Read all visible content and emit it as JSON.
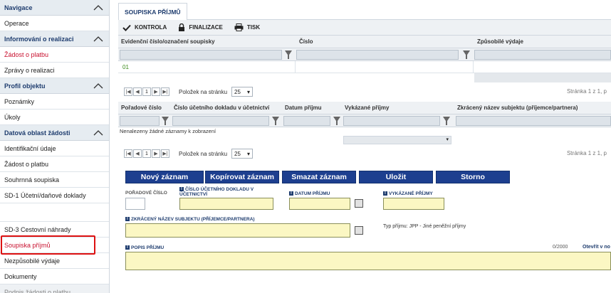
{
  "sidebar": {
    "sections": [
      {
        "title": "Navigace",
        "items": [
          "Operace"
        ]
      },
      {
        "title": "Informování o realizaci",
        "items": [
          "Žádost o platbu",
          "Zprávy o realizaci"
        ]
      },
      {
        "title": "Profil objektu",
        "items": [
          "Poznámky",
          "Úkoly"
        ]
      },
      {
        "title": "Datová oblast žádosti",
        "items": [
          "Identifikační údaje",
          "Žádost o platbu",
          "Souhrnná soupiska",
          "SD-1 Účetní/daňové doklady",
          "",
          "SD-3 Cestovní náhrady",
          "Soupiska příjmů",
          "Nezpůsobilé výdaje",
          "Dokumenty",
          "Podpis žádosti o platbu"
        ]
      }
    ]
  },
  "tab": {
    "label": "SOUPISKA PŘÍJMŮ"
  },
  "toolbar": {
    "kontrola": "KONTROLA",
    "finalizace": "FINALIZACE",
    "tisk": "TISK"
  },
  "grid1": {
    "headers": [
      "Evidenční číslo/označení soupisky",
      "Číslo",
      "Způsobilé výdaje"
    ],
    "rows": [
      [
        "01",
        "",
        ""
      ]
    ]
  },
  "pager1": {
    "page": "1",
    "label": "Položek na stránku",
    "size": "25",
    "info": "Stránka 1 z 1, p"
  },
  "grid2": {
    "headers": [
      "Pořadové číslo",
      "Číslo účetního dokladu v účetnictví",
      "Datum příjmu",
      "Vykázané příjmy",
      "Zkrácený název subjektu (příjemce/partnera)"
    ],
    "empty": "Nenalezeny žádné záznamy k zobrazení"
  },
  "pager2": {
    "page": "1",
    "label": "Položek na stránku",
    "size": "25",
    "info": "Stránka 1 z 1, p"
  },
  "buttons": {
    "new": "Nový záznam",
    "copy": "Kopírovat záznam",
    "delete": "Smazat záznam",
    "save": "Uložit",
    "cancel": "Storno"
  },
  "form": {
    "poradove": "POŘADOVÉ ČÍSLO",
    "cislo_dokladu": "ČÍSLO ÚČETNÍHO DOKLADU V ÚČETNICTVÍ",
    "datum": "DATUM PŘÍJMU",
    "vykazane": "VYKÁZANÉ PŘÍJMY",
    "zkraceny": "ZKRÁCENÝ NÁZEV SUBJEKTU (PŘÍJEMCE/PARTNERA)",
    "typ": "Typ příjmu: JPP - Jiné peněžní příjmy",
    "popis": "POPIS PŘÍJMU",
    "counter": "0/2000",
    "open": "Otevřít v no"
  },
  "colors": {
    "navy": "#1d3f8f",
    "red": "#c8102e",
    "yellow": "#fbf7c3"
  }
}
